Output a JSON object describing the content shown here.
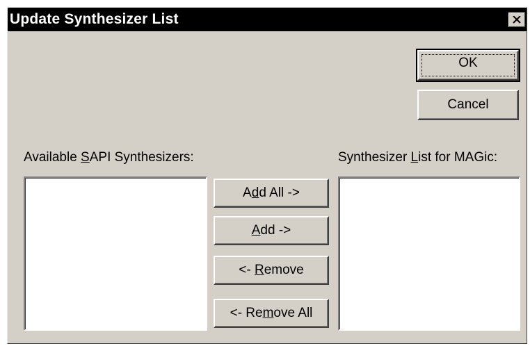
{
  "window": {
    "title": "Update Synthesizer List",
    "close_icon": "close-icon"
  },
  "buttons": {
    "ok": "OK",
    "cancel": "Cancel",
    "add_all": {
      "pre": "A",
      "mnemonic": "d",
      "post": "d All  ->"
    },
    "add": {
      "pre": "",
      "mnemonic": "A",
      "post": "dd  ->"
    },
    "remove": {
      "pre": "<-  ",
      "mnemonic": "R",
      "post": "emove"
    },
    "remove_all": {
      "pre": "<-  Re",
      "mnemonic": "m",
      "post": "ove All"
    }
  },
  "labels": {
    "available": {
      "pre": "Available ",
      "mnemonic": "S",
      "post": "API Synthesizers:"
    },
    "synth_list": {
      "pre": "Synthesizer ",
      "mnemonic": "L",
      "post": "ist for MAGic:"
    }
  },
  "lists": {
    "available_items": [],
    "synth_list_items": []
  }
}
